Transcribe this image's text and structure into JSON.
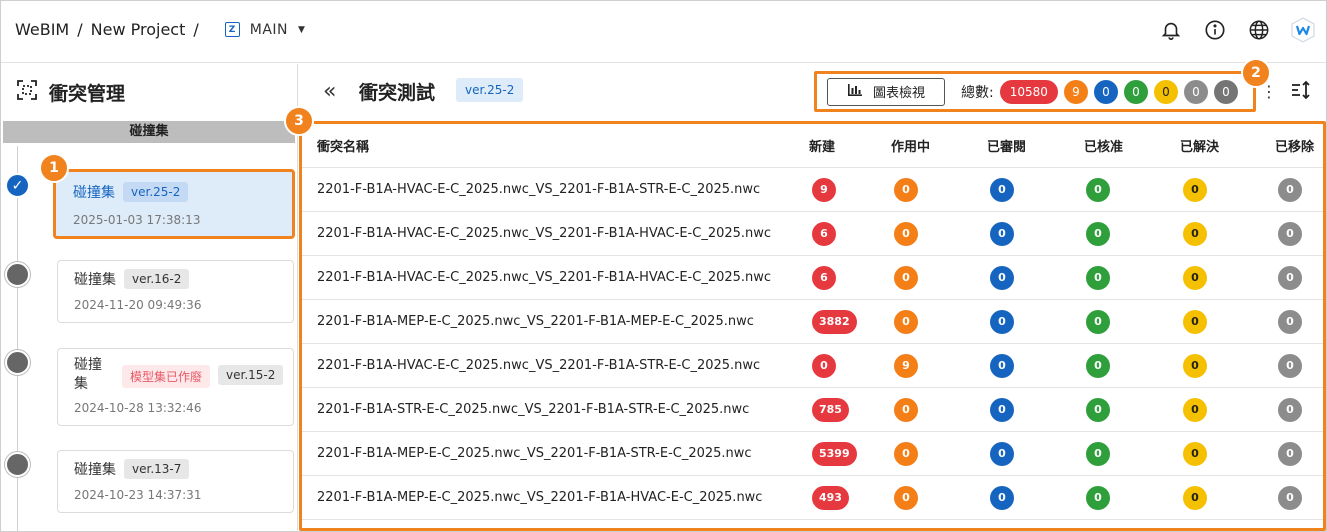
{
  "breadcrumb": {
    "root": "WeBIM",
    "sep": "/",
    "project": "New Project",
    "sep2": "/",
    "branch": "MAIN",
    "branch_icon_letter": "Z"
  },
  "sidebar": {
    "title": "衝突管理",
    "group_label": "碰撞集",
    "items": [
      {
        "title": "碰撞集",
        "version": "ver.25-2",
        "date": "2025-01-03 17:38:13",
        "active": true
      },
      {
        "title": "碰撞集",
        "version": "ver.16-2",
        "date": "2024-11-20 09:49:36",
        "active": false
      },
      {
        "title_line1": "碰撞",
        "title_line2": "集",
        "warning": "模型集已作廢",
        "version": "ver.15-2",
        "date": "2024-10-28 13:32:46",
        "active": false
      },
      {
        "title": "碰撞集",
        "version": "ver.13-7",
        "date": "2024-10-23 14:37:31",
        "active": false
      }
    ]
  },
  "main": {
    "title": "衝突測試",
    "version": "ver.25-2",
    "chart_view_label": "圖表檢視",
    "total_label": "總數:",
    "totals": [
      "10580",
      "9",
      "0",
      "0",
      "0",
      "0",
      "0"
    ]
  },
  "callouts": [
    "1",
    "2",
    "3"
  ],
  "table": {
    "headers": [
      "衝突名稱",
      "新建",
      "作用中",
      "已審閱",
      "已核准",
      "已解決",
      "已移除"
    ],
    "rows": [
      {
        "name": "2201-F-B1A-HVAC-E-C_2025.nwc_VS_2201-F-B1A-STR-E-C_2025.nwc",
        "values": [
          "9",
          "0",
          "0",
          "0",
          "0",
          "0"
        ]
      },
      {
        "name": "2201-F-B1A-HVAC-E-C_2025.nwc_VS_2201-F-B1A-HVAC-E-C_2025.nwc",
        "values": [
          "6",
          "0",
          "0",
          "0",
          "0",
          "0"
        ]
      },
      {
        "name": "2201-F-B1A-HVAC-E-C_2025.nwc_VS_2201-F-B1A-HVAC-E-C_2025.nwc",
        "values": [
          "6",
          "0",
          "0",
          "0",
          "0",
          "0"
        ]
      },
      {
        "name": "2201-F-B1A-MEP-E-C_2025.nwc_VS_2201-F-B1A-MEP-E-C_2025.nwc",
        "values": [
          "3882",
          "0",
          "0",
          "0",
          "0",
          "0"
        ]
      },
      {
        "name": "2201-F-B1A-HVAC-E-C_2025.nwc_VS_2201-F-B1A-STR-E-C_2025.nwc",
        "values": [
          "0",
          "9",
          "0",
          "0",
          "0",
          "0"
        ]
      },
      {
        "name": "2201-F-B1A-STR-E-C_2025.nwc_VS_2201-F-B1A-STR-E-C_2025.nwc",
        "values": [
          "785",
          "0",
          "0",
          "0",
          "0",
          "0"
        ]
      },
      {
        "name": "2201-F-B1A-MEP-E-C_2025.nwc_VS_2201-F-B1A-STR-E-C_2025.nwc",
        "values": [
          "5399",
          "0",
          "0",
          "0",
          "0",
          "0"
        ]
      },
      {
        "name": "2201-F-B1A-MEP-E-C_2025.nwc_VS_2201-F-B1A-HVAC-E-C_2025.nwc",
        "values": [
          "493",
          "0",
          "0",
          "0",
          "0",
          "0"
        ]
      }
    ]
  },
  "colors": {
    "accent": "#1565c0",
    "highlight": "#f0831e",
    "status": [
      "#e5393f",
      "#f57f17",
      "#1565c0",
      "#2e9f3a",
      "#f5c000",
      "#8c8c8c",
      "#8c8c8c"
    ]
  },
  "icons": [
    "bell-icon",
    "info-icon",
    "globe-icon",
    "webim-logo-icon",
    "clash-manage-icon",
    "double-chevron-left-icon",
    "bar-chart-icon",
    "more-vertical-icon",
    "sort-icon",
    "check-icon"
  ]
}
